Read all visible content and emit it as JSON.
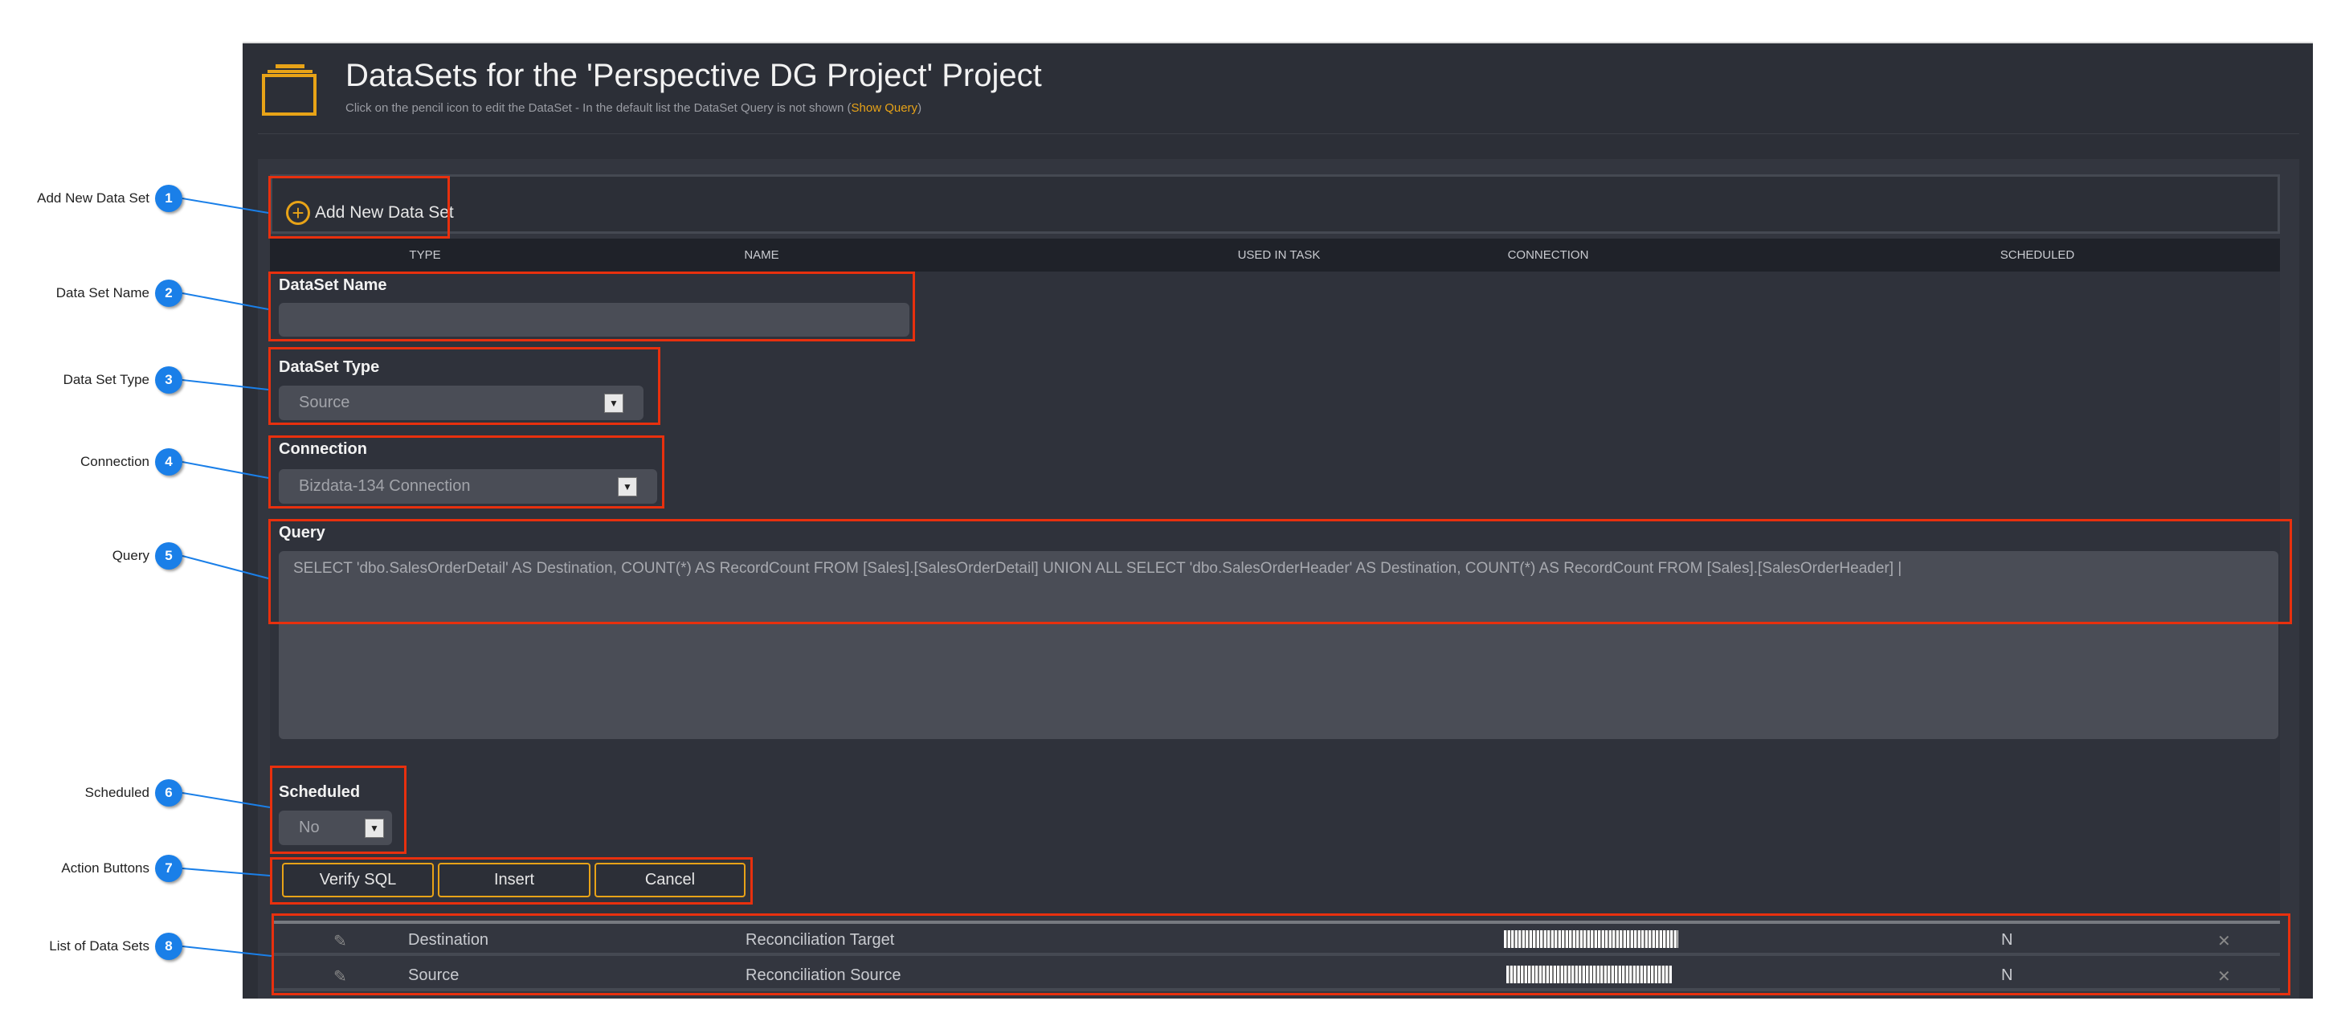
{
  "header": {
    "title": "DataSets for the 'Perspective DG Project' Project",
    "subtitle": "Click on the pencil icon to edit the DataSet - In the default list the DataSet Query is not shown (",
    "show_query": "Show Query",
    "subtitle_end": ")",
    "icon": "folder-stack-icon"
  },
  "add_button": "Add New Data Set",
  "table_headers": [
    "TYPE",
    "NAME",
    "USED IN TASK",
    "CONNECTION",
    "SCHEDULED"
  ],
  "form": {
    "name_label": "DataSet Name",
    "name_value": "",
    "type_label": "DataSet Type",
    "type_value": "Source",
    "connection_label": "Connection",
    "connection_value": "Bizdata-134 Connection",
    "query_label": "Query",
    "query_value": "SELECT 'dbo.SalesOrderDetail' AS Destination,  COUNT(*) AS RecordCount FROM [Sales].[SalesOrderDetail] UNION ALL SELECT 'dbo.SalesOrderHeader' AS Destination,  COUNT(*) AS RecordCount FROM [Sales].[SalesOrderHeader] |",
    "scheduled_label": "Scheduled",
    "scheduled_value": "No"
  },
  "buttons": {
    "verify": "Verify SQL",
    "insert": "Insert",
    "cancel": "Cancel"
  },
  "rows": [
    {
      "type": "Destination",
      "name": "Reconciliation Target",
      "scheduled": "N"
    },
    {
      "type": "Source",
      "name": "Reconciliation Source",
      "scheduled": "N"
    }
  ],
  "callouts": [
    {
      "n": "1",
      "label": "Add New Data Set"
    },
    {
      "n": "2",
      "label": "Data Set Name"
    },
    {
      "n": "3",
      "label": "Data Set Type"
    },
    {
      "n": "4",
      "label": "Connection"
    },
    {
      "n": "5",
      "label": "Query"
    },
    {
      "n": "6",
      "label": "Scheduled"
    },
    {
      "n": "7",
      "label": "Action Buttons"
    },
    {
      "n": "8",
      "label": "List of Data Sets"
    }
  ],
  "colors": {
    "accent": "#e8a317",
    "callout": "#1a7fe8",
    "highlight": "#e8300e",
    "background": "#2c2f37"
  }
}
